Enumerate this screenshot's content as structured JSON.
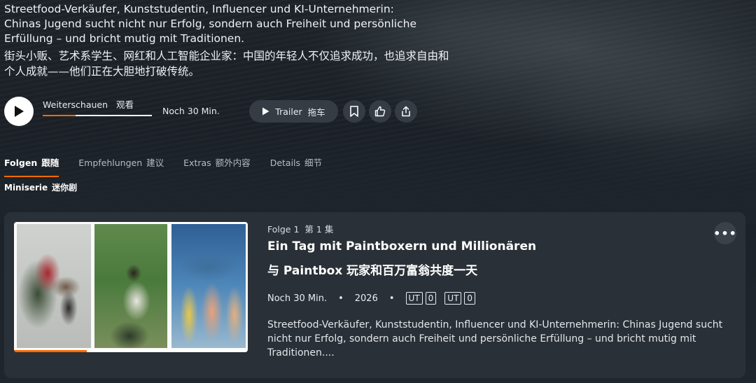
{
  "hero": {
    "description_de": "Streetfood-Verkäufer, Kunststudentin, Influencer und KI-Unternehmerin: Chinas Jugend sucht nicht nur Erfolg, sondern auch Freiheit und persön­liche Erfüllung – und bricht mutig mit Traditionen.",
    "description_zh": "街头小贩、艺术系学生、网红和人工智能企业家：中国的年轻人不仅追求成功，也追求自由和个人成就——他们正在大胆地打破传统。"
  },
  "player": {
    "play_icon": "play-icon",
    "continue_label_de": "Weiterschauen",
    "continue_label_zh": "观看",
    "progress_percent": 30,
    "remaining_time": "Noch 30 Min.",
    "trailer_label_de": "Trailer",
    "trailer_label_zh": "拖车",
    "bookmark_icon": "bookmark-icon",
    "like_icon": "thumbs-up-icon",
    "share_icon": "share-icon"
  },
  "tabs": [
    {
      "de": "Folgen",
      "zh": "跟随",
      "active": true
    },
    {
      "de": "Empfehlungen",
      "zh": "建议",
      "active": false
    },
    {
      "de": "Extras",
      "zh": "额外内容",
      "active": false
    },
    {
      "de": "Details",
      "zh": "细节",
      "active": false
    }
  ],
  "season": {
    "de": "Miniserie",
    "zh": "迷你剧"
  },
  "episode": {
    "number_de": "Folge 1",
    "number_zh": "第 1 集",
    "title_de": "Ein Tag mit Paintboxern und Millionären",
    "title_zh": "与 Paintbox 玩家和百万富翁共度一天",
    "remaining": "Noch 30 Min.",
    "year": "2026",
    "rating_1": [
      "UT",
      "0"
    ],
    "rating_2": [
      "UT",
      "0"
    ],
    "description": "Streetfood-Verkäufer, Kunststudentin, Influencer und KI-Unternehmerin: Chinas Jugend sucht nicht nur Erfolg, sondern auch Freiheit und persönliche Erfüllung – und bricht mutig mit Traditionen....",
    "thumb_progress_percent": 31,
    "more_label": "•••",
    "accent_color": "#ff6a00"
  }
}
